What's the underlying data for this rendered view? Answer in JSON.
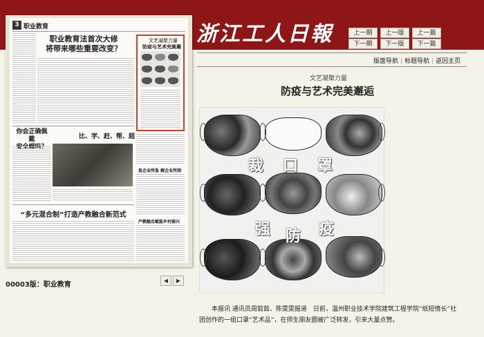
{
  "masthead": "浙江工人日報",
  "nav": {
    "prev_issue": "上一期",
    "next_issue": "下一期",
    "prev_page": "上一版",
    "next_page": "下一版",
    "prev_article": "上一篇",
    "next_article": "下一篇"
  },
  "links": {
    "page_nav": "版面导航",
    "title_nav": "标题导航",
    "home": "返回主页"
  },
  "thumbnail": {
    "page_number": "3",
    "section": "职业教育",
    "headline": "职业教育法首次大修\n将带来哪些重要改变？",
    "boxed_kicker": "文艺凝聚力量",
    "boxed_title": "防疫与艺术完美邂逅",
    "side_title1": "你会正确佩戴\n安全帽吗？",
    "side_title2": "比、学、赶、帮、超",
    "side_title3": "急企业所急 解企业所困",
    "side_title4": "产教融合赋能乡村振兴",
    "bottom_headline": "“多元混合制”打造产教融合新范式"
  },
  "page_label": "00003版：职业教育",
  "page_prev_icon": "left-arrow-icon",
  "page_next_icon": "right-arrow-icon",
  "article": {
    "kicker": "文艺凝聚力量",
    "title": "防疫与艺术完美邂逅",
    "overlay_chars": [
      "裁",
      "口",
      "罩",
      "强",
      "防",
      "疫"
    ],
    "body": "本报讯 通讯员周茹茹、陈雯雯报道　日前，温州职业技术学院建筑工程学院“纸短情长”社团创作的一组口罩“艺术品”，在师生朋友圈被广泛转发，引来大量点赞。"
  }
}
